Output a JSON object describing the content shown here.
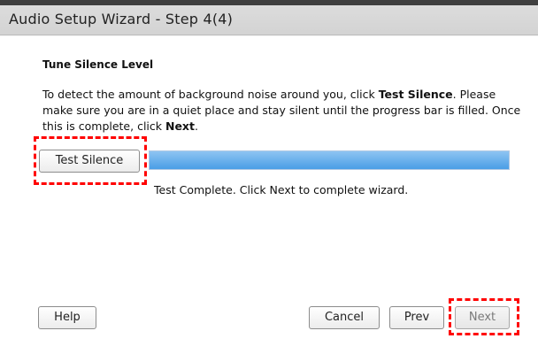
{
  "window": {
    "title": "Audio Setup Wizard - Step 4(4)"
  },
  "main": {
    "heading": "Tune Silence Level",
    "description": {
      "part1": "To detect the amount of background noise around you, click ",
      "bold1": "Test Silence",
      "part2": ". Please make sure you are in a quiet place and stay silent until the progress bar is filled. Once this is complete, click ",
      "bold2": "Next",
      "part3": "."
    },
    "test_button_label": "Test Silence",
    "progress_percent": 100,
    "progress_color": "#4a9ee6",
    "status_text": "Test Complete. Click Next to complete wizard."
  },
  "footer": {
    "help_label": "Help",
    "cancel_label": "Cancel",
    "prev_label": "Prev",
    "next_label": "Next"
  },
  "highlight_color": "#ff0000"
}
